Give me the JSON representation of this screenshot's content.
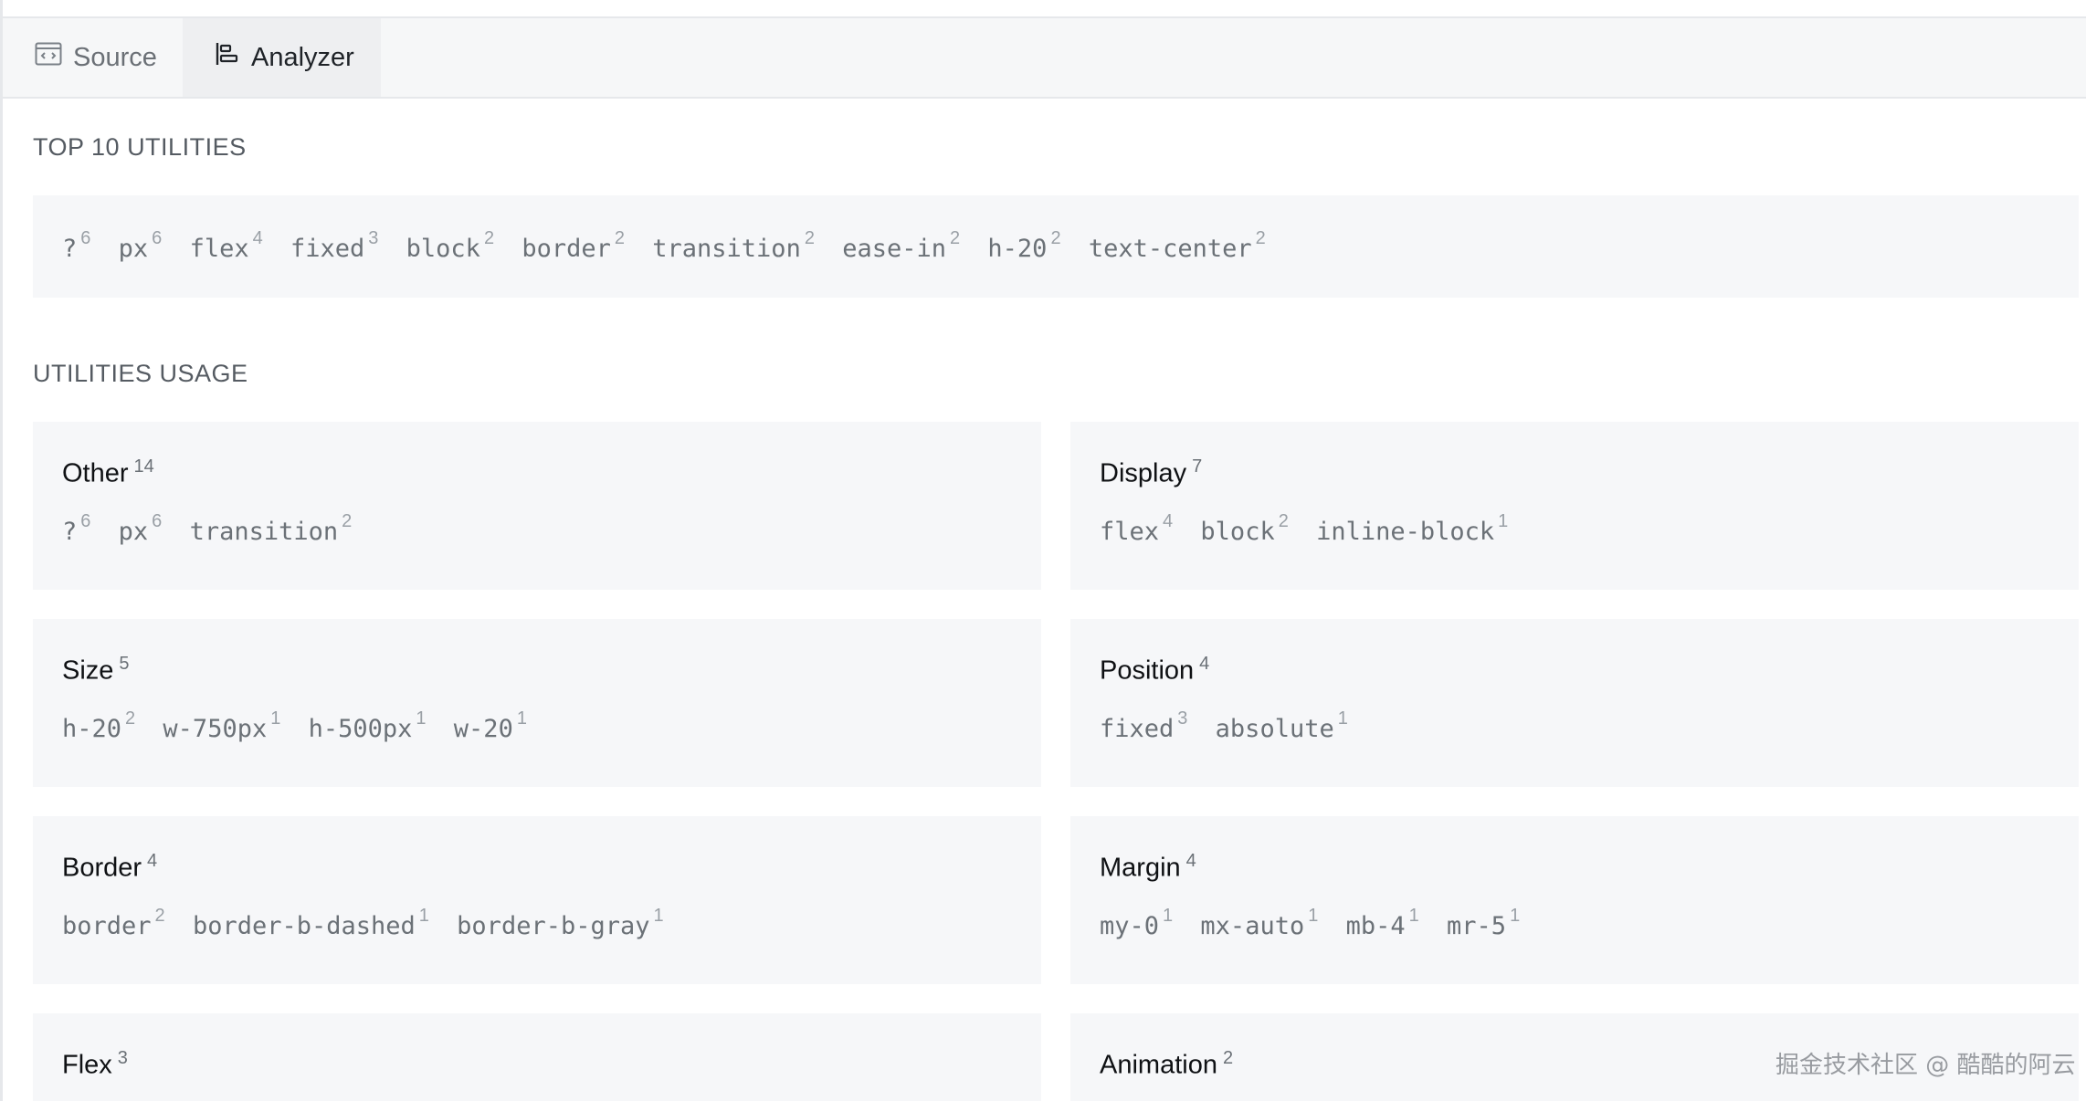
{
  "tabs": [
    {
      "label": "Source",
      "icon": "code-window-icon",
      "active": false
    },
    {
      "label": "Analyzer",
      "icon": "align-left-bars-icon",
      "active": true
    }
  ],
  "top_utilities": {
    "title": "TOP 10 UTILITIES",
    "items": [
      {
        "name": "?",
        "count": "6"
      },
      {
        "name": "px",
        "count": "6"
      },
      {
        "name": "flex",
        "count": "4"
      },
      {
        "name": "fixed",
        "count": "3"
      },
      {
        "name": "block",
        "count": "2"
      },
      {
        "name": "border",
        "count": "2"
      },
      {
        "name": "transition",
        "count": "2"
      },
      {
        "name": "ease-in",
        "count": "2"
      },
      {
        "name": "h-20",
        "count": "2"
      },
      {
        "name": "text-center",
        "count": "2"
      }
    ]
  },
  "usage": {
    "title": "UTILITIES USAGE",
    "cards": [
      {
        "title": "Other",
        "count": "14",
        "items": [
          {
            "name": "?",
            "count": "6"
          },
          {
            "name": "px",
            "count": "6"
          },
          {
            "name": "transition",
            "count": "2"
          }
        ]
      },
      {
        "title": "Display",
        "count": "7",
        "items": [
          {
            "name": "flex",
            "count": "4"
          },
          {
            "name": "block",
            "count": "2"
          },
          {
            "name": "inline-block",
            "count": "1"
          }
        ]
      },
      {
        "title": "Size",
        "count": "5",
        "items": [
          {
            "name": "h-20",
            "count": "2"
          },
          {
            "name": "w-750px",
            "count": "1"
          },
          {
            "name": "h-500px",
            "count": "1"
          },
          {
            "name": "w-20",
            "count": "1"
          }
        ]
      },
      {
        "title": "Position",
        "count": "4",
        "items": [
          {
            "name": "fixed",
            "count": "3"
          },
          {
            "name": "absolute",
            "count": "1"
          }
        ]
      },
      {
        "title": "Border",
        "count": "4",
        "items": [
          {
            "name": "border",
            "count": "2"
          },
          {
            "name": "border-b-dashed",
            "count": "1"
          },
          {
            "name": "border-b-gray",
            "count": "1"
          }
        ]
      },
      {
        "title": "Margin",
        "count": "4",
        "items": [
          {
            "name": "my-0",
            "count": "1"
          },
          {
            "name": "mx-auto",
            "count": "1"
          },
          {
            "name": "mb-4",
            "count": "1"
          },
          {
            "name": "mr-5",
            "count": "1"
          }
        ]
      },
      {
        "title": "Flex",
        "count": "3",
        "items": []
      },
      {
        "title": "Animation",
        "count": "2",
        "items": []
      }
    ]
  },
  "watermark": "掘金技术社区 @ 酷酷的阿云"
}
